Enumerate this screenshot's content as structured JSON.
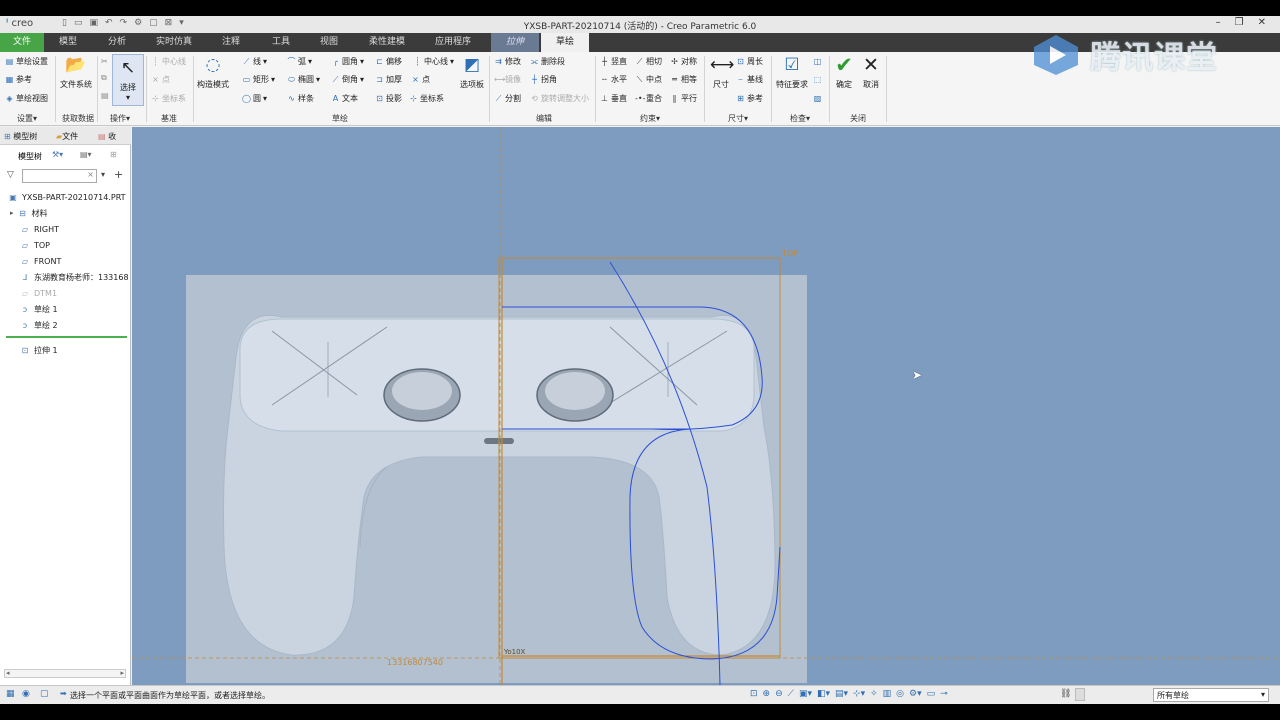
{
  "app": {
    "logo": "creo",
    "window_title": "YXSB-PART-20210714 (活动的) - Creo Parametric 6.0"
  },
  "tabs": [
    {
      "label": "文件"
    },
    {
      "label": "模型"
    },
    {
      "label": "分析"
    },
    {
      "label": "实时仿真"
    },
    {
      "label": "注释"
    },
    {
      "label": "工具"
    },
    {
      "label": "视图"
    },
    {
      "label": "柔性建模"
    },
    {
      "label": "应用程序"
    },
    {
      "label": "拉伸"
    },
    {
      "label": "草绘"
    }
  ],
  "ribbon": {
    "setup": {
      "items": [
        "草绘设置",
        "参考",
        "草绘视图"
      ],
      "label": "设置"
    },
    "get_data": {
      "big": "文件系统",
      "label": "获取数据"
    },
    "operations": {
      "big": "选择",
      "label": "操作"
    },
    "datum": {
      "items": [
        "中心线",
        "点",
        "坐标系"
      ],
      "label": "基准"
    },
    "construction_mode": "构造模式",
    "sketch": {
      "items": [
        "线",
        "弧",
        "圆角",
        "偏移",
        "中心线",
        "矩形",
        "椭圆",
        "倒角",
        "加厚",
        "点",
        "圆",
        "样条",
        "文本",
        "投影",
        "坐标系"
      ],
      "palette": "选项板",
      "label": "草绘"
    },
    "edit": {
      "items": [
        "修改",
        "删除段",
        "镜像",
        "拐角",
        "分割",
        "旋转调整大小"
      ],
      "label": "编辑"
    },
    "constrain": {
      "items": [
        "竖直",
        "相切",
        "对称",
        "水平",
        "中点",
        "相等",
        "垂直",
        "重合",
        "平行"
      ],
      "label": "约束"
    },
    "dimension": {
      "big": "尺寸",
      "items": [
        "周长",
        "基线",
        "参考"
      ],
      "label": "尺寸"
    },
    "inspect": {
      "big": "特征要求",
      "label": "检查"
    },
    "close": {
      "ok": "确定",
      "cancel": "取消",
      "label": "关闭"
    }
  },
  "watermark": "腾讯课堂",
  "left_panel": {
    "tabs": [
      "模型树",
      "文件",
      "收"
    ],
    "tool_label": "模型树",
    "tree": [
      {
        "label": "YXSB-PART-20210714.PRT",
        "icon": "part-icon",
        "dim": false
      },
      {
        "label": "材料",
        "icon": "material-icon",
        "dim": false
      },
      {
        "label": "RIGHT",
        "icon": "plane-icon",
        "dim": false
      },
      {
        "label": "TOP",
        "icon": "plane-icon",
        "dim": false
      },
      {
        "label": "FRONT",
        "icon": "plane-icon",
        "dim": false
      },
      {
        "label": "东湖教育杨老师：133168",
        "icon": "csys-icon",
        "dim": false
      },
      {
        "label": "DTM1",
        "icon": "plane-icon",
        "dim": true
      },
      {
        "label": "草绘 1",
        "icon": "sketch-icon",
        "dim": false
      },
      {
        "label": "草绘 2",
        "icon": "sketch-icon",
        "dim": false
      },
      {
        "label": "拉伸 1",
        "icon": "extrude-icon",
        "dim": false
      }
    ]
  },
  "viewport": {
    "plane_label": "TOP",
    "bottom_note": "13316807540",
    "axis_note": "Yo10X"
  },
  "statusbar": {
    "message": "选择一个平面或平面曲面作为草绘平面，或者选择草绘。",
    "filter_value": "所有草绘"
  },
  "colors": {
    "viewport_bg": "#7e9cc0",
    "file_tab": "#47a447",
    "sketch_curve": "#2a4fd6",
    "ref_frame": "#c08a3a"
  }
}
